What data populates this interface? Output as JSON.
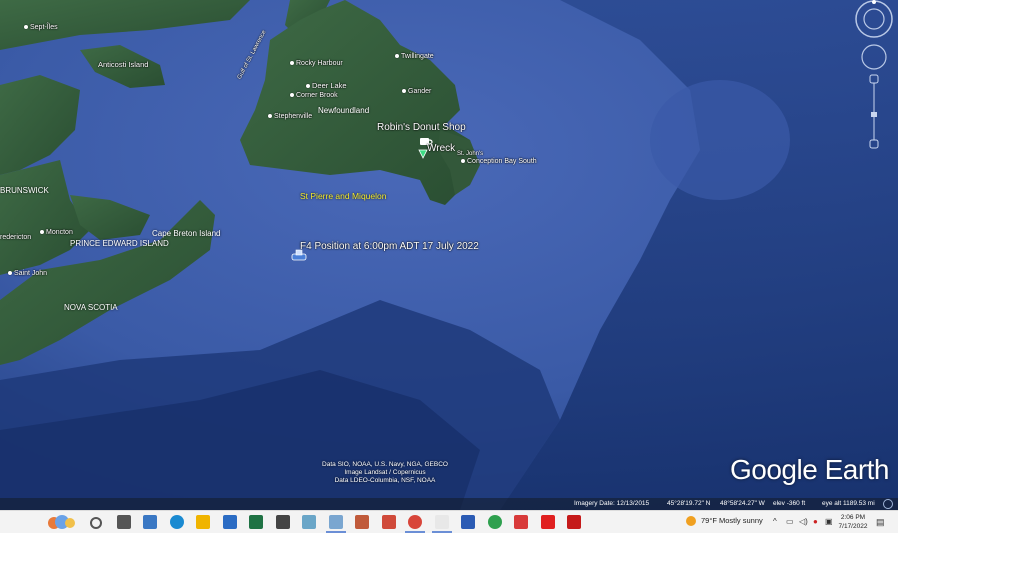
{
  "map": {
    "places": [
      {
        "id": "sept-iles",
        "label": "Sept-Îles"
      },
      {
        "id": "anticosti",
        "label": "Anticosti Island"
      },
      {
        "id": "gulf",
        "label": "Gulf of St. Lawrence"
      },
      {
        "id": "rocky-harbour",
        "label": "Rocky Harbour"
      },
      {
        "id": "twillingate",
        "label": "Twillingate"
      },
      {
        "id": "deer-lake",
        "label": "Deer Lake"
      },
      {
        "id": "gander",
        "label": "Gander"
      },
      {
        "id": "corner-brook",
        "label": "Corner Brook"
      },
      {
        "id": "newfoundland",
        "label": "Newfoundland"
      },
      {
        "id": "stephenville",
        "label": "Stephenville"
      },
      {
        "id": "st-johns",
        "label": "St. John's"
      },
      {
        "id": "conception-bay",
        "label": "Conception Bay South"
      },
      {
        "id": "new-brunswick",
        "label": "BRUNSWICK"
      },
      {
        "id": "fredericton",
        "label": "redericton"
      },
      {
        "id": "moncton",
        "label": "Moncton"
      },
      {
        "id": "pei",
        "label": "PRINCE EDWARD ISLAND"
      },
      {
        "id": "cape-breton",
        "label": "Cape Breton Island"
      },
      {
        "id": "saint-john",
        "label": "Saint John"
      },
      {
        "id": "nova-scotia",
        "label": "NOVA SCOTIA"
      },
      {
        "id": "st-pierre",
        "label": "St Pierre and Miquelon"
      }
    ],
    "robins": "Robin's Donut Shop",
    "wreck": "Wreck",
    "f4_position": "F4 Position at 6:00pm ADT 17 July 2022",
    "credits": [
      "Data SIO, NOAA, U.S. Navy, NGA, GEBCO",
      "Image Landsat / Copernicus",
      "Data LDEO-Columbia, NSF, NOAA"
    ],
    "logo": "Google Earth",
    "status": {
      "imagery_date": "Imagery Date: 12/13/2015",
      "lat": "45°28'19.72\" N",
      "lon": "48°58'24.27\" W",
      "elev": "elev  -360 ft",
      "eye_alt": "eye alt 1189.53 mi"
    }
  },
  "taskbar": {
    "weather": "79°F  Mostly sunny",
    "time": "2:06 PM",
    "date": "7/17/2022",
    "icons": [
      {
        "name": "search-icon",
        "color": "#555555"
      },
      {
        "name": "task-view-icon",
        "color": "#555555"
      },
      {
        "name": "app-icon-1",
        "color": "#3a78c4"
      },
      {
        "name": "edge-icon",
        "color": "#1a8ad1"
      },
      {
        "name": "file-explorer-icon",
        "color": "#f0b400"
      },
      {
        "name": "store-icon",
        "color": "#2b6cc4"
      },
      {
        "name": "excel-icon",
        "color": "#1f7244"
      },
      {
        "name": "app-icon-2",
        "color": "#444444"
      },
      {
        "name": "app-icon-3",
        "color": "#6aa6c8"
      },
      {
        "name": "paint-icon",
        "color": "#7aa6d0"
      },
      {
        "name": "app-icon-4",
        "color": "#c05a3a"
      },
      {
        "name": "calculator-icon",
        "color": "#d04a3a"
      },
      {
        "name": "chrome-icon",
        "color": "#d8453a"
      },
      {
        "name": "notepad-icon",
        "color": "#e8e8e8"
      },
      {
        "name": "snipping-icon",
        "color": "#2b5bb4"
      },
      {
        "name": "google-drive-icon",
        "color": "#2ea04e"
      },
      {
        "name": "app-icon-5",
        "color": "#d83a3a"
      },
      {
        "name": "youtube-icon",
        "color": "#e02020"
      },
      {
        "name": "acrobat-icon",
        "color": "#c51a1a"
      }
    ]
  }
}
